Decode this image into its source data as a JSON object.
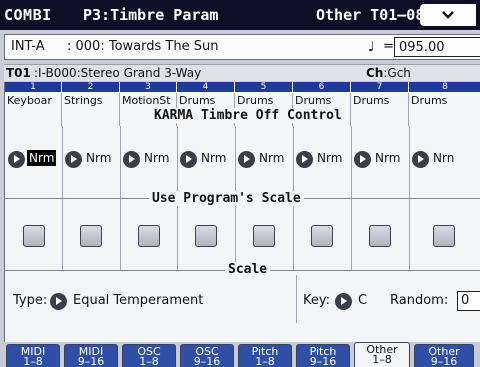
{
  "header": {
    "mode": "COMBI",
    "page": "P3:Timbre Param",
    "range": "Other T01–08",
    "menu_icon": "chevron-down-icon"
  },
  "combi": {
    "bank": "INT-A",
    "number_name": ": 000: Towards The Sun",
    "tempo_symbol": "♩",
    "tempo_eq": "=",
    "tempo": "095.00"
  },
  "info": {
    "timbre": "T01",
    "program": ":I-B000:Stereo Grand 3-Way",
    "ch_label": "Ch",
    "ch_value": ":Gch"
  },
  "timbres": [
    {
      "num": "1",
      "name": "Keyboar",
      "karma": "Nrm",
      "selected": true
    },
    {
      "num": "2",
      "name": "Strings",
      "karma": "Nrm",
      "selected": false
    },
    {
      "num": "3",
      "name": "MotionSt",
      "karma": "Nrm",
      "selected": false
    },
    {
      "num": "4",
      "name": "Drums",
      "karma": "Nrm",
      "selected": false
    },
    {
      "num": "5",
      "name": "Drums",
      "karma": "Nrm",
      "selected": false
    },
    {
      "num": "6",
      "name": "Drums",
      "karma": "Nrm",
      "selected": false
    },
    {
      "num": "7",
      "name": "Drums",
      "karma": "Nrm",
      "selected": false
    },
    {
      "num": "8",
      "name": "Drums",
      "karma": "Nrn",
      "selected": false
    }
  ],
  "sections": {
    "karma_title": "KARMA Timbre Off Control",
    "use_scale_title": "Use Program's Scale",
    "scale_title": "Scale"
  },
  "scale": {
    "type_label": "Type:",
    "type_value": "Equal Temperament",
    "key_label": "Key:",
    "key_value": "C",
    "random_label": "Random:",
    "random_value": "0"
  },
  "tabs": [
    {
      "label": "MIDI\n1–8",
      "active": false
    },
    {
      "label": "MIDI\n9–16",
      "active": false
    },
    {
      "label": "OSC\n1–8",
      "active": false
    },
    {
      "label": "OSC\n9–16",
      "active": false
    },
    {
      "label": "Pitch\n1–8",
      "active": false
    },
    {
      "label": "Pitch\n9–16",
      "active": false
    },
    {
      "label": "Other\n1–8",
      "active": true
    },
    {
      "label": "Other\n9–16",
      "active": false
    }
  ]
}
